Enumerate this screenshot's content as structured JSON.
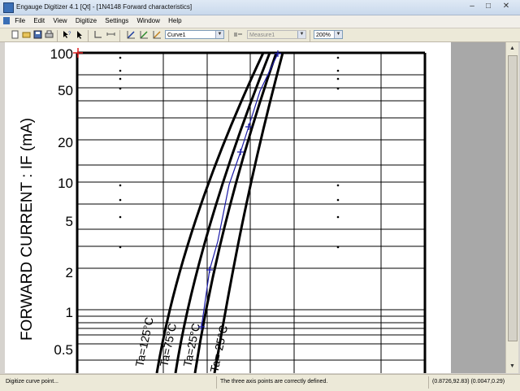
{
  "window": {
    "title": "Engauge Digitizer 4.1 [Qt] - [1N4148 Forward characteristics]",
    "controls": [
      "–",
      "□",
      "✕"
    ]
  },
  "menu": [
    "File",
    "Edit",
    "View",
    "Digitize",
    "Settings",
    "Window",
    "Help"
  ],
  "toolbar": {
    "curve_combo": "Curve1",
    "measure_combo": "Measure1",
    "zoom_combo": "200%"
  },
  "plot": {
    "y_axis_label": "FORWARD CURRENT : IF (mA)",
    "y_ticks": [
      "100",
      "50",
      "20",
      "10",
      "5",
      "2",
      "1",
      "0.5"
    ],
    "curve_labels": [
      "Ta=125°C",
      "Ta=75°C",
      "Ta=25°C",
      "Ta=-25°C"
    ]
  },
  "status": {
    "left": "Digitize curve point...",
    "middle": "The three axis points are correctly defined.",
    "right": "(0.8726,92.83) (0.0047,0.29)"
  },
  "colors": {
    "digitized_curve": "#1a1aa8",
    "axis_point": "#e02020"
  }
}
